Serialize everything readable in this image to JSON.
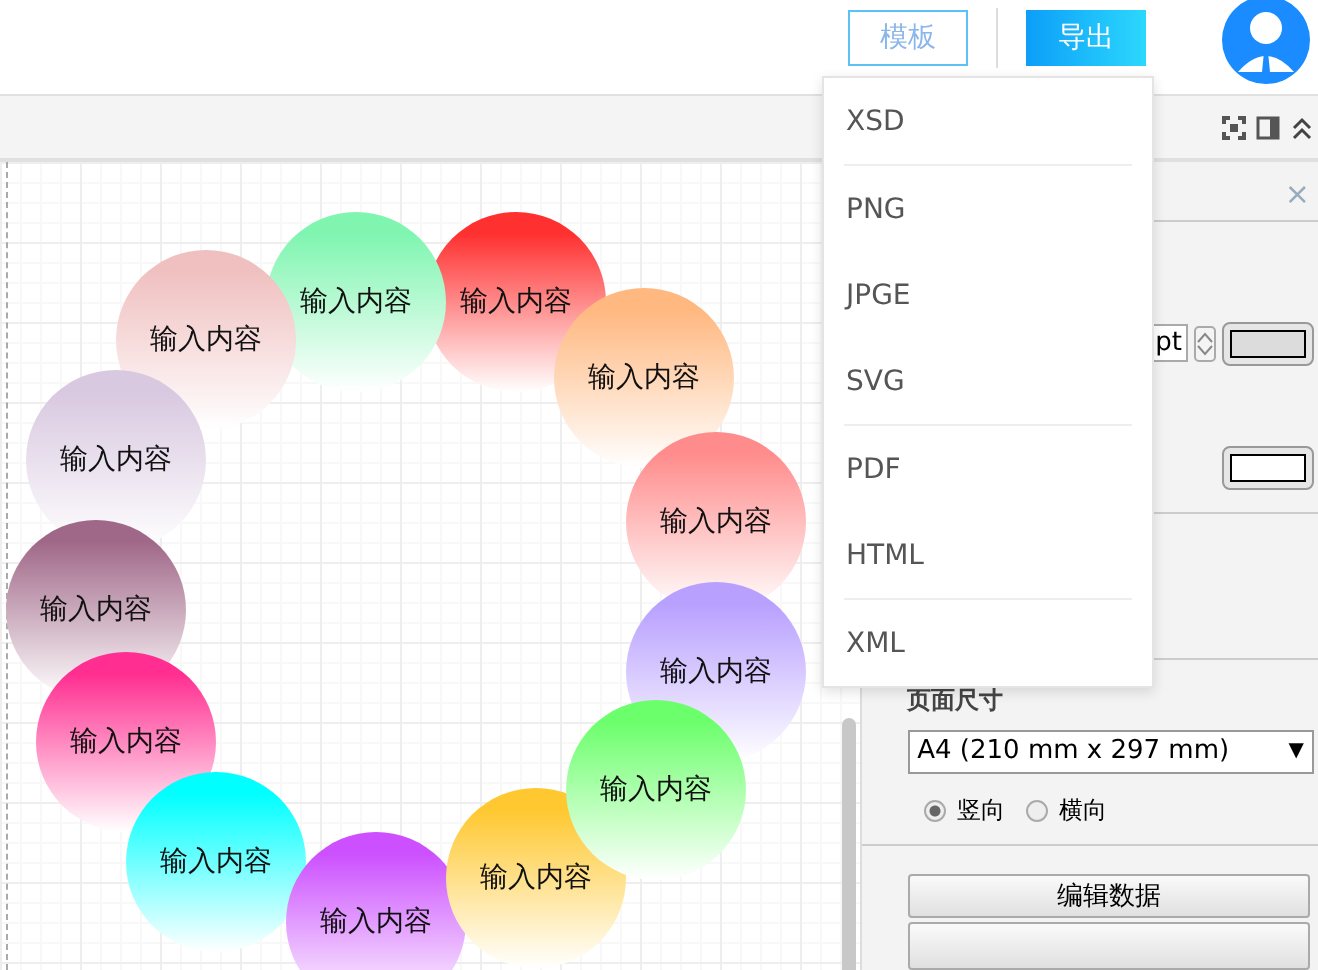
{
  "header": {
    "buttons": [
      {
        "label": "模板",
        "kind": "outline"
      },
      {
        "label": "导出",
        "kind": "primary"
      }
    ]
  },
  "export_menu": {
    "items": [
      {
        "label": "XSD",
        "separator_after": true
      },
      {
        "label": "PNG",
        "separator_after": false
      },
      {
        "label": "JPGE",
        "separator_after": false
      },
      {
        "label": "SVG",
        "separator_after": true
      },
      {
        "label": "PDF",
        "separator_after": false
      },
      {
        "label": "HTML",
        "separator_after": true
      },
      {
        "label": "XML",
        "separator_after": false
      }
    ]
  },
  "canvas": {
    "nodes": [
      {
        "label": "输入内容",
        "color": "#ff3030"
      },
      {
        "label": "输入内容",
        "color": "#7ff5b0"
      },
      {
        "label": "输入内容",
        "color": "#f0c0c0"
      },
      {
        "label": "输入内容",
        "color": "#d8c8e0"
      },
      {
        "label": "输入内容",
        "color": "#a06888"
      },
      {
        "label": "输入内容",
        "color": "#ff2e90"
      },
      {
        "label": "输入内容",
        "color": "#00ffff"
      },
      {
        "label": "输入内容",
        "color": "#cc50ff"
      },
      {
        "label": "输入内容",
        "color": "#ffc830"
      },
      {
        "label": "输入内容",
        "color": "#ffb880"
      },
      {
        "label": "输入内容",
        "color": "#ff8c8c"
      },
      {
        "label": "输入内容",
        "color": "#b8a0ff"
      },
      {
        "label": "输入内容",
        "color": "#6cff6c"
      }
    ]
  },
  "panel": {
    "close": "×",
    "unit": "pt",
    "page_size": {
      "label": "页面尺寸",
      "value": "A4 (210 mm x 297 mm)",
      "caret": "▼"
    },
    "orientation": [
      {
        "label": "竖向",
        "selected": true
      },
      {
        "label": "横向",
        "selected": false
      }
    ],
    "buttons": [
      "编辑数据"
    ]
  }
}
